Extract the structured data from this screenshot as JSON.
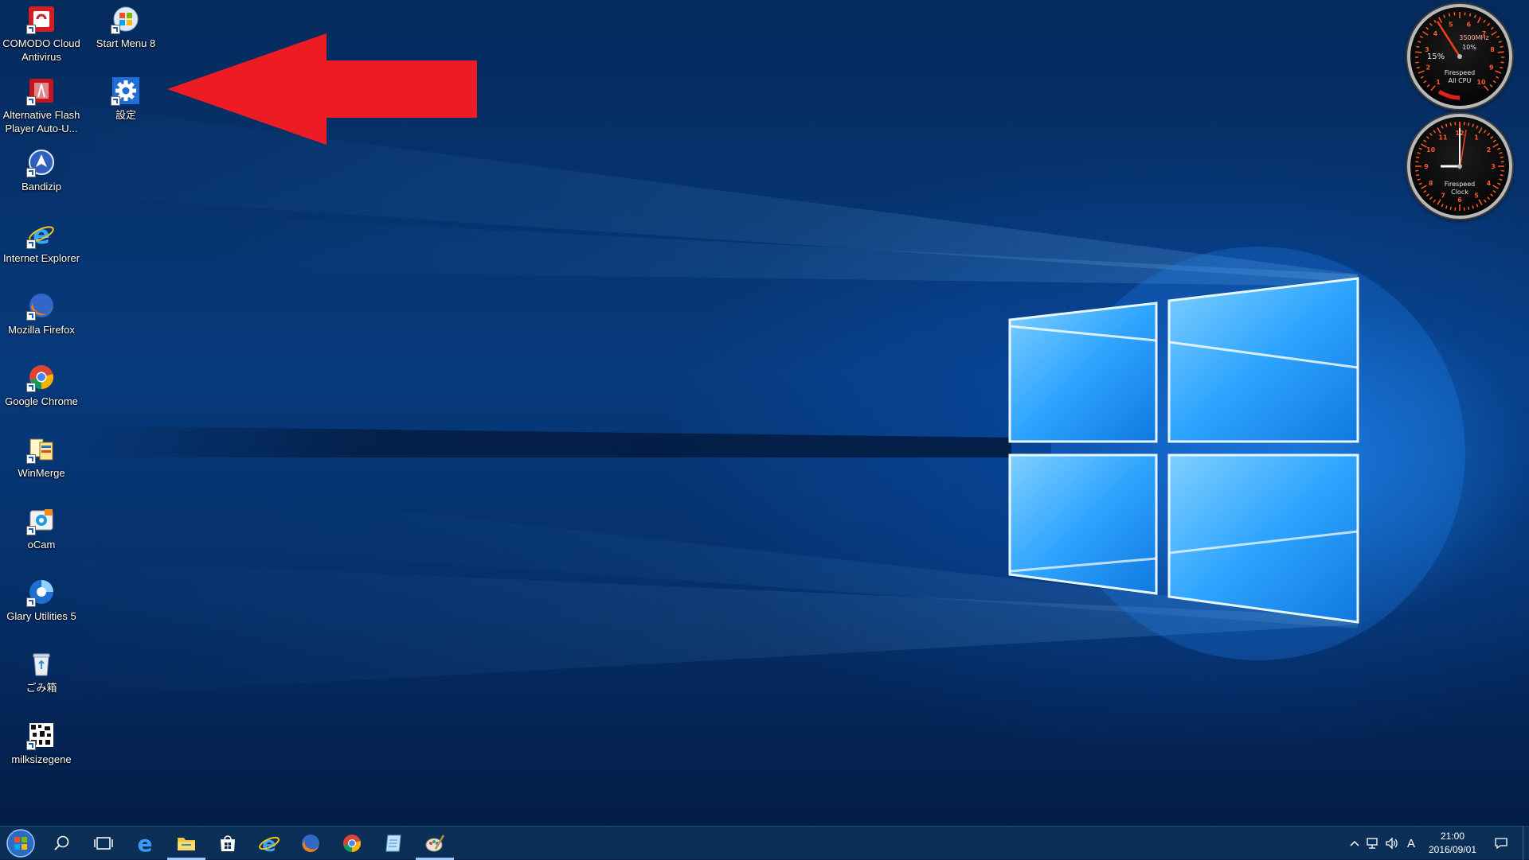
{
  "desktop": {
    "icons_col1": [
      {
        "label": "COMODO Cloud Antivirus",
        "icon": "comodo-antivirus-icon"
      },
      {
        "label": "Alternative Flash Player Auto-U...",
        "icon": "flash-updater-icon"
      },
      {
        "label": "Bandizip",
        "icon": "bandizip-icon"
      },
      {
        "label": "Internet Explorer",
        "icon": "internet-explorer-icon"
      },
      {
        "label": "Mozilla Firefox",
        "icon": "firefox-icon"
      },
      {
        "label": "Google Chrome",
        "icon": "chrome-icon"
      },
      {
        "label": "WinMerge",
        "icon": "winmerge-icon"
      },
      {
        "label": "oCam",
        "icon": "ocam-icon"
      },
      {
        "label": "Glary Utilities 5",
        "icon": "glary-utilities-icon"
      },
      {
        "label": "ごみ箱",
        "icon": "recycle-bin-icon"
      },
      {
        "label": "milksizegene",
        "icon": "milksizegene-icon"
      }
    ],
    "icons_col2": [
      {
        "label": "Start Menu 8",
        "icon": "start-menu-8-icon"
      },
      {
        "label": "設定",
        "icon": "settings-gear-icon"
      }
    ],
    "annotation": {
      "icon": "red-arrow-pointing-left",
      "color": "#ED1C24"
    }
  },
  "gadgets": {
    "cpu_meter": {
      "value_text": "15%",
      "freq_text": "3500MHz",
      "small_pct": "10%",
      "title_line1": "Firespeed",
      "title_line2": "All CPU",
      "dial_labels": [
        "1",
        "2",
        "3",
        "4",
        "5",
        "6",
        "7",
        "8",
        "9",
        "10"
      ]
    },
    "clock": {
      "title_line1": "Firespeed",
      "title_line2": "Clock",
      "dial_labels": [
        "12",
        "1",
        "2",
        "3",
        "4",
        "5",
        "6",
        "7",
        "8",
        "9",
        "10",
        "11"
      ]
    }
  },
  "taskbar": {
    "buttons": [
      {
        "name": "start-button",
        "icon": "start-orb-icon"
      },
      {
        "name": "search-button",
        "icon": "search-icon"
      },
      {
        "name": "task-view-button",
        "icon": "task-view-icon"
      },
      {
        "name": "edge-button",
        "icon": "edge-icon"
      },
      {
        "name": "file-explorer-button",
        "icon": "file-explorer-icon"
      },
      {
        "name": "store-button",
        "icon": "store-icon"
      },
      {
        "name": "ie-button",
        "icon": "internet-explorer-icon"
      },
      {
        "name": "firefox-button",
        "icon": "firefox-icon"
      },
      {
        "name": "chrome-button",
        "icon": "chrome-icon"
      },
      {
        "name": "notes-button",
        "icon": "notes-icon"
      },
      {
        "name": "paint-button",
        "icon": "paint-icon"
      }
    ],
    "tray": {
      "ime_label": "A",
      "time": "21:00",
      "date": "2016/09/01"
    }
  },
  "colors": {
    "taskbar_bg": "#0c2f57",
    "wallpaper_accent": "#2f9bff",
    "gadget_needle": "#ff3b1f"
  }
}
